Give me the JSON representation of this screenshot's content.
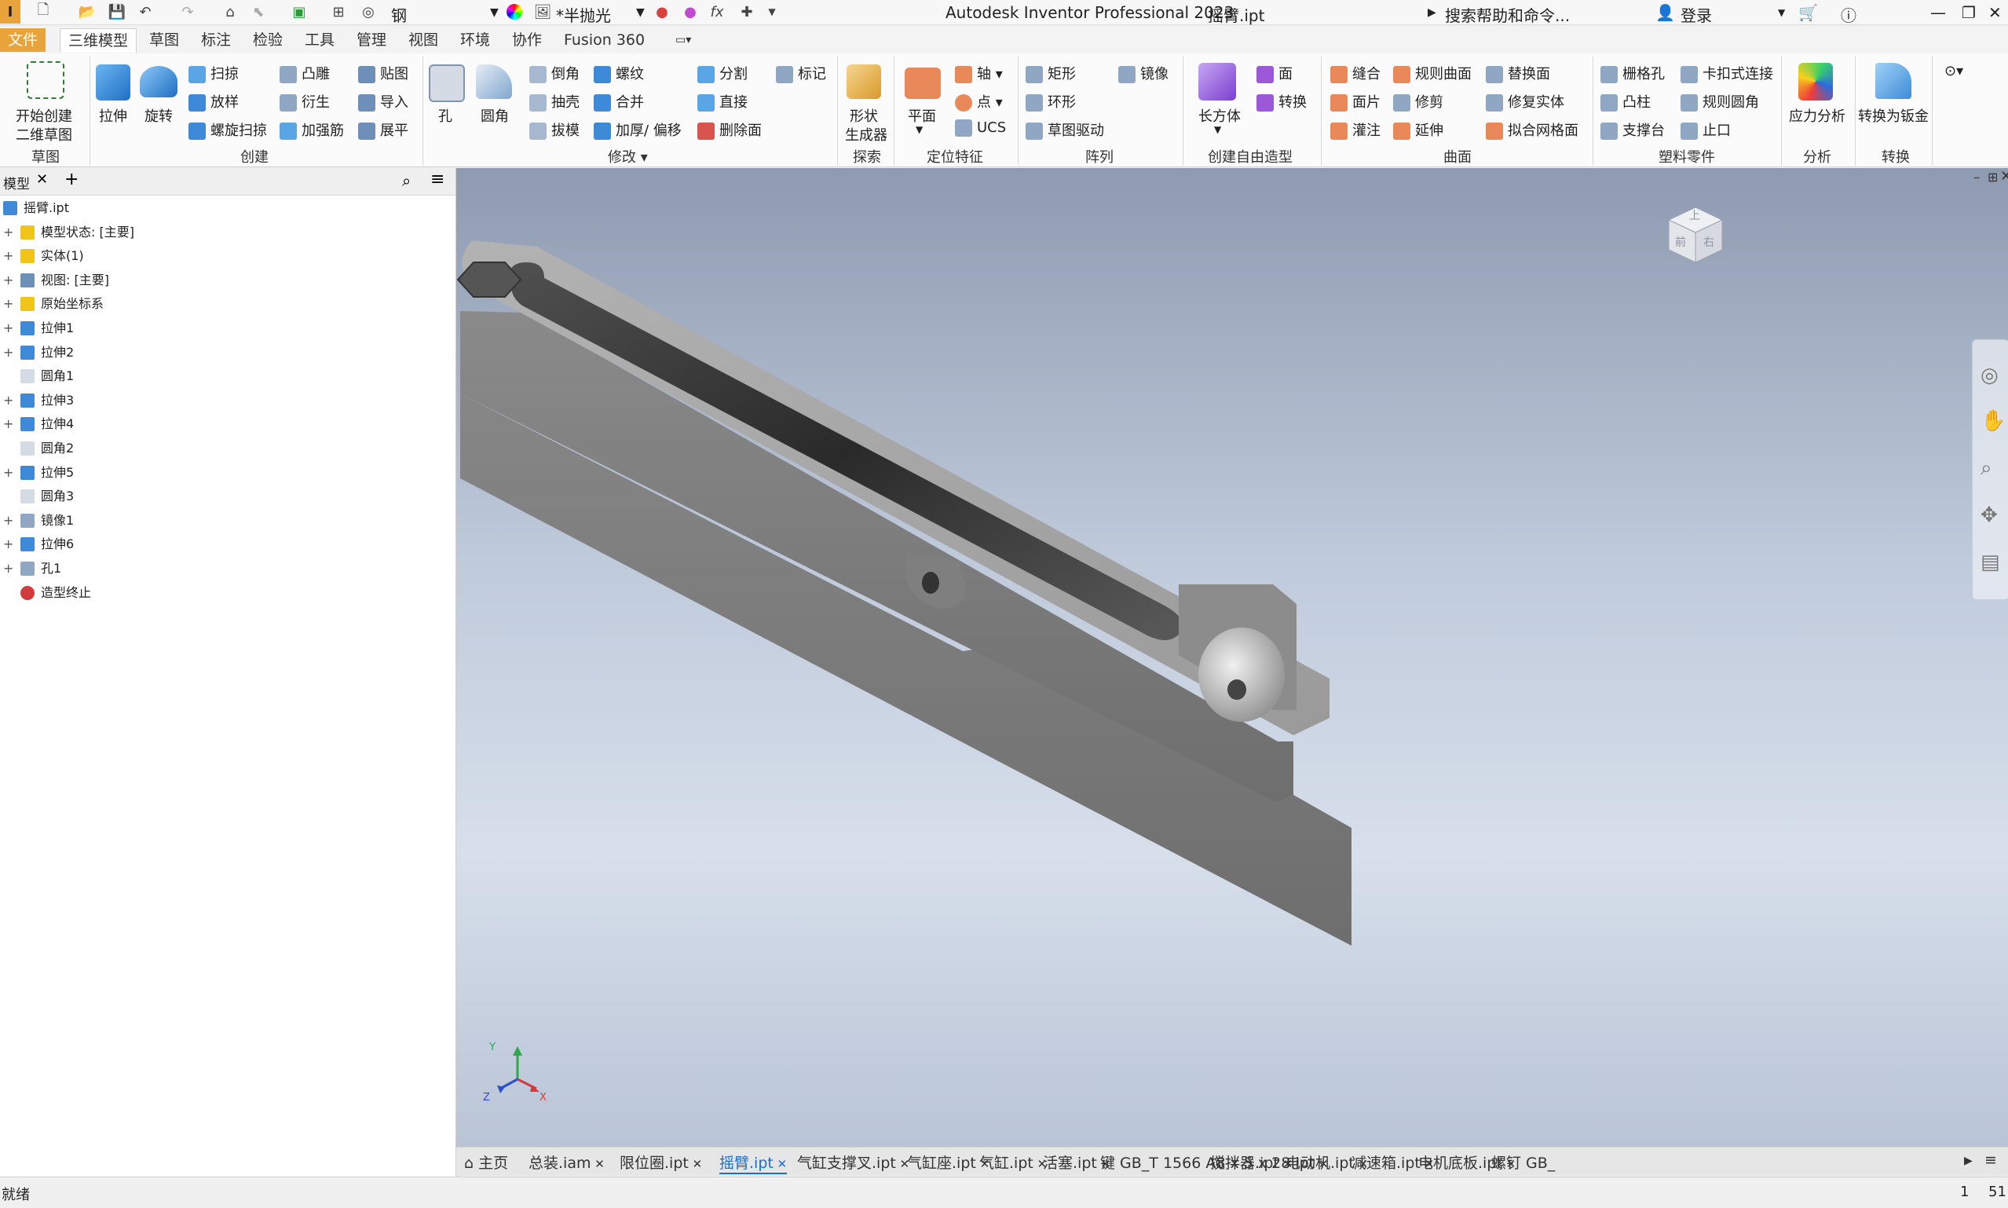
{
  "titlebar": {
    "material": "钢",
    "appearance": "*半抛光",
    "title": "Autodesk Inventor Professional 2023",
    "filename": "摇臂.ipt",
    "search_placeholder": "搜索帮助和命令...",
    "login": "登录"
  },
  "menu_tabs": {
    "file": "文件",
    "t3d": "三维模型",
    "sketch": "草图",
    "annotate": "标注",
    "inspect": "检验",
    "tools": "工具",
    "manage": "管理",
    "view": "视图",
    "env": "环境",
    "collab": "协作",
    "fusion": "Fusion 360"
  },
  "ribbon": {
    "start_sketch_1": "开始创建",
    "start_sketch_2": "二维草图",
    "extrude": "拉伸",
    "revolve": "旋转",
    "sweep": "扫掠",
    "loft": "放样",
    "coil": "螺旋扫掠",
    "emboss": "凸雕",
    "derive": "衍生",
    "rib": "加强筋",
    "decal": "贴图",
    "import": "导入",
    "unfold": "展平",
    "hole": "孔",
    "fillet": "圆角",
    "chamfer": "倒角",
    "shell": "抽壳",
    "draft": "拔模",
    "thread": "螺纹",
    "combine": "合并",
    "thicken": "加厚/ 偏移",
    "split": "分割",
    "direct": "直接",
    "delete_face": "删除面",
    "mark": "标记",
    "shape_gen_1": "形状",
    "shape_gen_2": "生成器",
    "plane": "平面",
    "axis": "轴",
    "point": "点",
    "ucs": "UCS",
    "rect": "矩形",
    "circ": "环形",
    "sketch_driven": "草图驱动",
    "mirror": "镜像",
    "box": "长方体",
    "face": "面",
    "convert": "转换",
    "stitch": "缝合",
    "patch": "面片",
    "sculpt": "灌注",
    "ruled": "规则曲面",
    "trim": "修剪",
    "extend": "延伸",
    "replace": "替换面",
    "repair": "修复实体",
    "fit_mesh": "拟合网格面",
    "grill": "栅格孔",
    "boss": "凸柱",
    "rest": "支撑台",
    "snap": "卡扣式连接",
    "rule_fillet": "规则圆角",
    "lip": "止口",
    "stress": "应力分析",
    "to_sheet": "转换为钣金",
    "g_sketch": "草图",
    "g_create": "创建",
    "g_modify": "修改",
    "g_explore": "探索",
    "g_workfeat": "定位特征",
    "g_pattern": "阵列",
    "g_freeform": "创建自由造型",
    "g_surface": "曲面",
    "g_plastic": "塑料零件",
    "g_analysis": "分析",
    "g_convert": "转换"
  },
  "browser": {
    "tab": "模型",
    "items": [
      {
        "label": "摇臂.ipt",
        "plus": ""
      },
      {
        "label": "模型状态: [主要]",
        "plus": "+"
      },
      {
        "label": "实体(1)",
        "plus": "+"
      },
      {
        "label": "视图: [主要]",
        "plus": "+"
      },
      {
        "label": "原始坐标系",
        "plus": "+"
      },
      {
        "label": "拉伸1",
        "plus": "+"
      },
      {
        "label": "拉伸2",
        "plus": "+"
      },
      {
        "label": "圆角1",
        "plus": ""
      },
      {
        "label": "拉伸3",
        "plus": "+"
      },
      {
        "label": "拉伸4",
        "plus": "+"
      },
      {
        "label": "圆角2",
        "plus": ""
      },
      {
        "label": "拉伸5",
        "plus": "+"
      },
      {
        "label": "圆角3",
        "plus": ""
      },
      {
        "label": "镜像1",
        "plus": "+"
      },
      {
        "label": "拉伸6",
        "plus": "+"
      },
      {
        "label": "孔1",
        "plus": "+"
      },
      {
        "label": "造型终止",
        "plus": ""
      }
    ]
  },
  "viewcube": {
    "top": "上",
    "front": "前",
    "right": "右"
  },
  "triad": {
    "x": "X",
    "y": "Y",
    "z": "Z"
  },
  "doc_tabs": {
    "home": "主页",
    "tabs": [
      "总装.iam",
      "限位圈.ipt",
      "摇臂.ipt",
      "气缸支撑叉.ipt",
      "气缸座.ipt",
      "气缸.ipt",
      "活塞.ipt",
      "键 GB_T 1566 A8 x 5 x 28.ipt",
      "搅拌器.ipt",
      "电动机.ipt",
      "减速箱.ipt",
      "电机底板.ipt",
      "螺钉 GB_"
    ]
  },
  "status": {
    "text": "就绪",
    "n1": "1",
    "n2": "51"
  }
}
